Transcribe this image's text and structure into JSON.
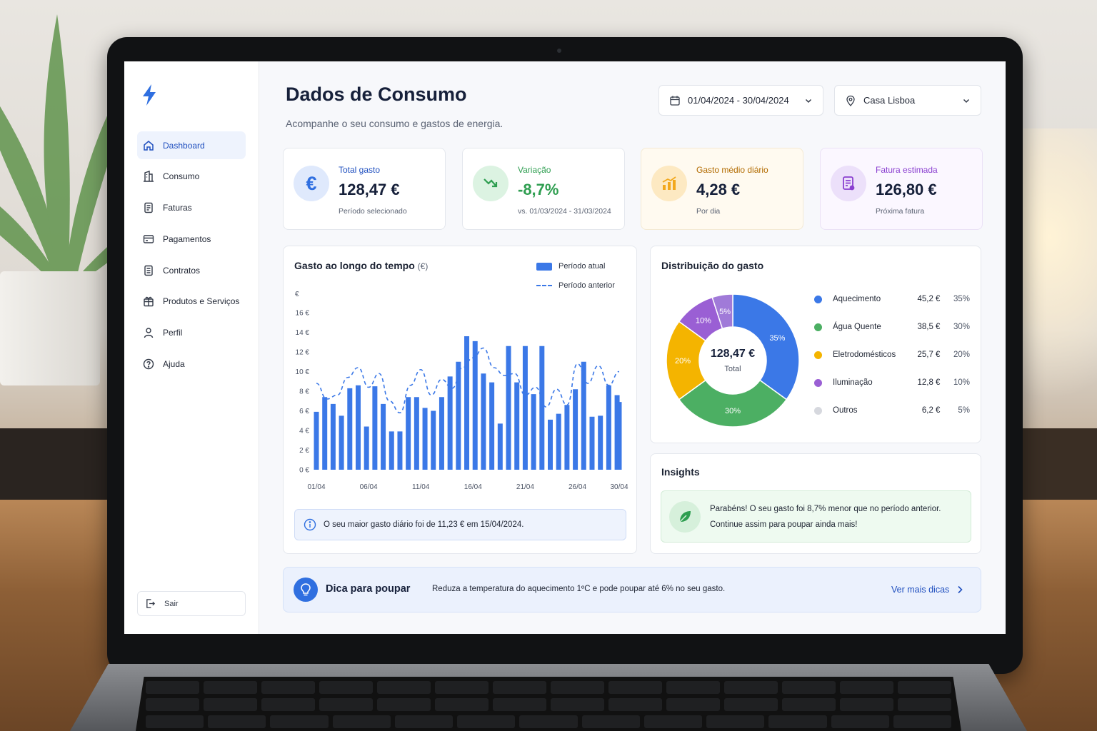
{
  "app": {
    "title": "Dados de Consumo",
    "subtitle": "Acompanhe o seu consumo e gastos de energia.",
    "accent": "#2f6fe0"
  },
  "sidebar": {
    "items": [
      {
        "label": "Dashboard",
        "icon": "home-icon",
        "active": true
      },
      {
        "label": "Consumo",
        "icon": "building-icon"
      },
      {
        "label": "Faturas",
        "icon": "document-icon"
      },
      {
        "label": "Pagamentos",
        "icon": "card-icon"
      },
      {
        "label": "Contratos",
        "icon": "contract-icon"
      },
      {
        "label": "Produtos e Serviços",
        "icon": "gift-icon"
      },
      {
        "label": "Perfil",
        "icon": "user-icon"
      },
      {
        "label": "Ajuda",
        "icon": "help-icon"
      }
    ],
    "logout_label": "Sair"
  },
  "filters": {
    "date_range": "01/04/2024 - 30/04/2024",
    "location": "Casa Lisboa"
  },
  "kpis": [
    {
      "label": "Total gasto",
      "value": "128,47 €",
      "sub": "Período selecionado",
      "color": "#2f6fe0",
      "icon": "euro-icon"
    },
    {
      "label": "Variação",
      "value": "-8,7%",
      "sub": "vs. 01/03/2024 - 31/03/2024",
      "color": "#2e9e50",
      "icon": "trend-down-icon"
    },
    {
      "label": "Gasto médio diário",
      "value": "4,28 €",
      "sub": "Por dia",
      "color": "#b26b00",
      "icon": "bar-chart-icon"
    },
    {
      "label": "Fatura estimada",
      "value": "126,80 €",
      "sub": "Próxima fatura",
      "color": "#8a3fd0",
      "icon": "invoice-icon"
    }
  ],
  "time_chart": {
    "title": "Gasto ao longo do tempo",
    "unit": "(€)",
    "info": "O seu maior gasto diário foi de 11,23 € em 15/04/2024."
  },
  "distribution": {
    "title": "Distribuição do gasto",
    "total_value": "128,47 €",
    "total_label": "Total",
    "items": [
      {
        "name": "Aquecimento",
        "amount": "45,2 €",
        "pct": "35%",
        "color": "#3b78e7"
      },
      {
        "name": "Água Quente",
        "amount": "38,5 €",
        "pct": "30%",
        "color": "#4caf63"
      },
      {
        "name": "Eletrodomésticos",
        "amount": "25,7 €",
        "pct": "20%",
        "color": "#f4b400"
      },
      {
        "name": "Iluminação",
        "amount": "12,8 €",
        "pct": "10%",
        "color": "#9a5fd4"
      },
      {
        "name": "Outros",
        "amount": "6,2 €",
        "pct": "5%",
        "color": "#d6d8de"
      }
    ]
  },
  "insights": {
    "title": "Insights",
    "line1": "Parabéns! O seu gasto foi 8,7% menor que no período anterior.",
    "line2": "Continue assim para poupar ainda mais!"
  },
  "tip": {
    "title": "Dica para poupar",
    "text": "Reduza a temperatura do aquecimento 1ºC e pode poupar até 6% no seu gasto.",
    "link": "Ver mais dicas"
  },
  "chart_data": [
    {
      "type": "bar",
      "title": "Gasto ao longo do tempo (€)",
      "ylabel": "€",
      "ylim": [
        0,
        16
      ],
      "yticks": [
        "0 €",
        "2 €",
        "4 €",
        "6 €",
        "8 €",
        "10 €",
        "12 €",
        "14 €",
        "16 €"
      ],
      "xticks": [
        "01/04",
        "06/04",
        "11/04",
        "16/04",
        "21/04",
        "26/04",
        "30/04"
      ],
      "grid": false,
      "legend_position": "top-right",
      "series": [
        {
          "name": "Período atual",
          "style": "bar",
          "color": "#3b78e7",
          "values": [
            5.9,
            7.4,
            6.7,
            5.5,
            8.3,
            8.6,
            4.4,
            8.5,
            6.7,
            3.9,
            3.9,
            7.4,
            7.4,
            6.3,
            6.0,
            7.4,
            9.5,
            11.0,
            13.6,
            13.1,
            9.8,
            8.9,
            4.7,
            12.6,
            8.9,
            12.6,
            7.7,
            12.6,
            5.1,
            5.7,
            6.6,
            8.2,
            11.0,
            5.4,
            5.5,
            8.6,
            7.6,
            6.9
          ],
          "x": [
            1,
            1.8,
            2.6,
            3.4,
            4.2,
            5,
            5.8,
            6.6,
            7.4,
            8.2,
            9,
            9.8,
            10.6,
            11.4,
            12.2,
            13,
            13.8,
            14.6,
            15.4,
            16.2,
            17,
            17.8,
            18.6,
            19.4,
            20.2,
            21,
            21.8,
            22.6,
            23.4,
            24.2,
            25,
            25.8,
            26.6,
            27.4,
            28.2,
            29,
            29.8,
            30
          ]
        },
        {
          "name": "Período anterior",
          "style": "dashed-line",
          "color": "#3b78e7",
          "x": [
            1,
            2,
            3,
            4,
            5,
            6,
            7,
            8,
            9,
            10,
            11,
            12,
            13,
            14,
            15,
            16,
            17,
            18,
            19,
            20,
            21,
            22,
            23,
            24,
            25,
            26,
            27,
            28,
            29,
            30
          ],
          "values": [
            8.8,
            7.2,
            7.6,
            9.4,
            10.4,
            8.4,
            9.8,
            7.0,
            5.8,
            8.6,
            10.2,
            7.6,
            9.2,
            8.3,
            10.4,
            11.4,
            12.4,
            10.4,
            9.6,
            9.8,
            7.6,
            8.4,
            6.4,
            8.2,
            6.6,
            10.8,
            8.8,
            10.6,
            8.6,
            10.0
          ]
        }
      ]
    },
    {
      "type": "pie",
      "title": "Distribuição do gasto",
      "categories": [
        "Aquecimento",
        "Água Quente",
        "Eletrodomésticos",
        "Iluminação",
        "Outros"
      ],
      "values": [
        35,
        30,
        20,
        10,
        5
      ],
      "labels": [
        "35%",
        "30%",
        "20%",
        "10%",
        "5%"
      ],
      "colors": [
        "#3b78e7",
        "#4caf63",
        "#f4b400",
        "#9a5fd4",
        "#a07ad8"
      ],
      "center_value": "128,47 €",
      "center_label": "Total",
      "legend_position": "right"
    }
  ]
}
